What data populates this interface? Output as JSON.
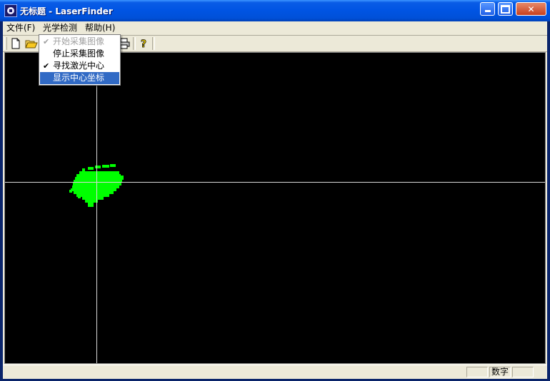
{
  "window": {
    "title": "无标题 - LaserFinder",
    "icon": "laser-target-icon",
    "controls": [
      "minimize-icon",
      "maximize-icon",
      "close-icon"
    ]
  },
  "menubar": {
    "file": "文件(F)",
    "optical": "光学检测",
    "help": "帮助(H)"
  },
  "toolbar": {
    "icons": [
      "new-file-icon",
      "open-folder-icon",
      "print-icon",
      "help-icon"
    ]
  },
  "dropdown": {
    "items": [
      {
        "label": "开始采集图像",
        "checked": true,
        "enabled": false,
        "highlighted": false
      },
      {
        "label": "停止采集图像",
        "checked": false,
        "enabled": true,
        "highlighted": false
      },
      {
        "label": "寻找激光中心",
        "checked": true,
        "enabled": true,
        "highlighted": false
      },
      {
        "label": "显示中心坐标",
        "checked": false,
        "enabled": true,
        "highlighted": true
      }
    ],
    "check_glyph": "✔"
  },
  "viewport": {
    "background": "#000000",
    "spot_color": "#00ff00",
    "crosshair_color": "#d8d8d8"
  },
  "statusbar": {
    "panes": [
      "",
      "数字",
      ""
    ]
  },
  "colors": {
    "title_blue": "#0054e3",
    "menu_highlight": "#316ac5",
    "face": "#ece9d8"
  }
}
